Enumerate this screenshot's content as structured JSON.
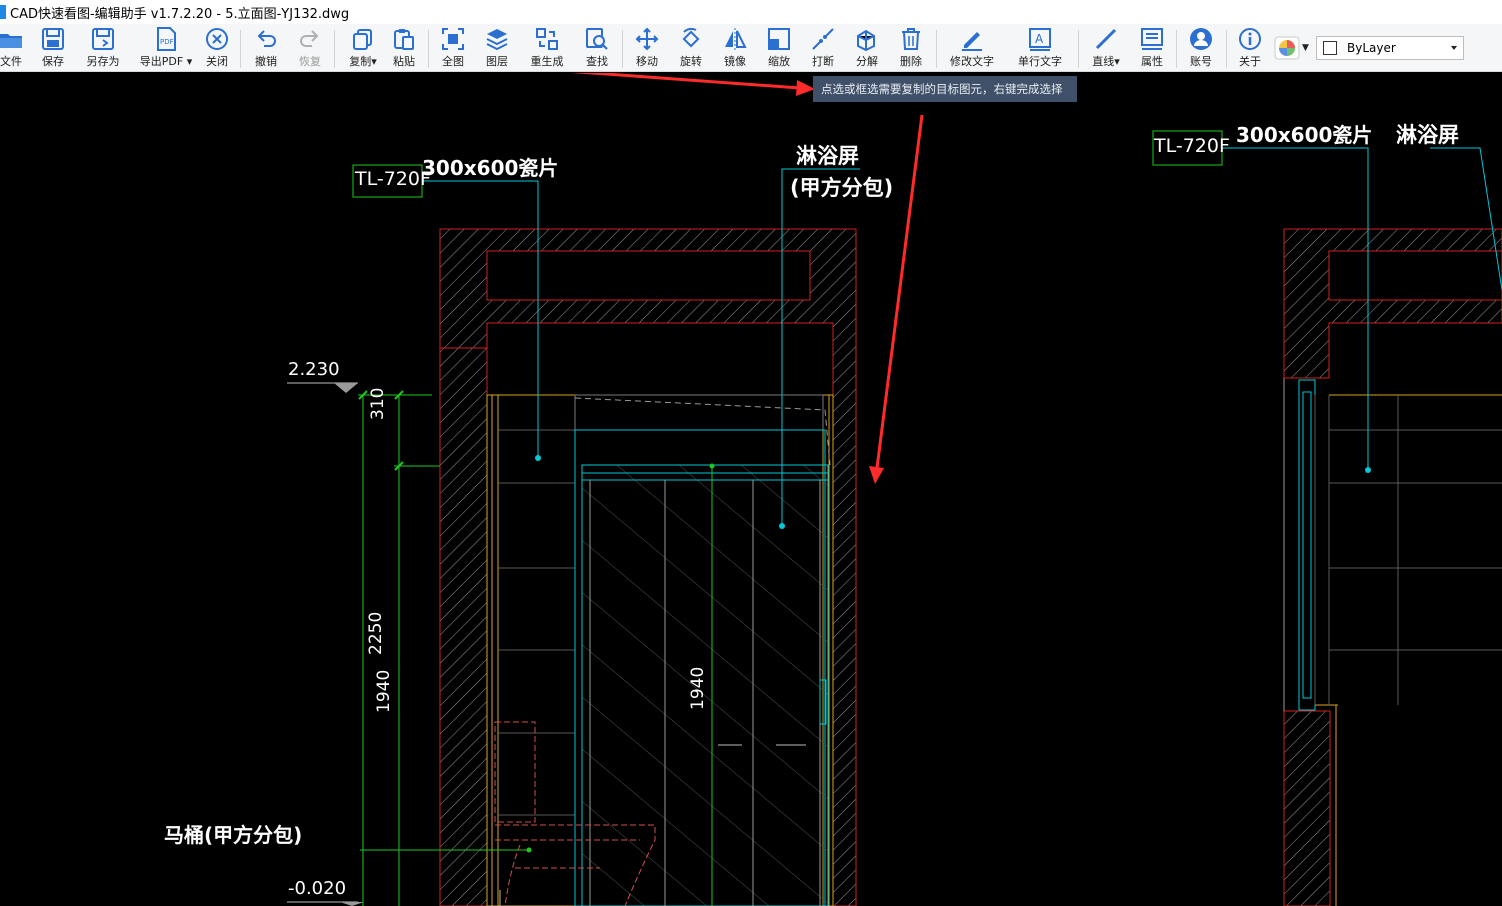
{
  "window": {
    "title": "CAD快速看图-编辑助手 v1.7.2.20 - 5.立面图-YJ132.dwg"
  },
  "toolbar": {
    "file": "文件",
    "save": "保存",
    "save_as": "另存为",
    "export_pdf": "导出PDF",
    "close": "关闭",
    "undo": "撤销",
    "redo": "恢复",
    "copy": "复制",
    "paste": "粘贴",
    "full_view": "全图",
    "layers": "图层",
    "regen": "重生成",
    "find": "查找",
    "move": "移动",
    "rotate": "旋转",
    "mirror": "镜像",
    "scale": "缩放",
    "break": "打断",
    "explode": "分解",
    "delete": "删除",
    "edit_text": "修改文字",
    "single_text": "单行文字",
    "line": "直线",
    "properties": "属性",
    "account": "账号",
    "about": "关于",
    "layer_value": "ByLayer"
  },
  "tooltip": {
    "text": "点选或框选需要复制的目标图元，右键完成选择"
  },
  "drawing": {
    "tag_left": "TL-720F",
    "tile_left": "300x600瓷片",
    "shower_left": "淋浴屏",
    "shower_left_note": "(甲方分包)",
    "tag_right": "TL-720F",
    "tile_right": "300x600瓷片",
    "shower_right": "淋浴屏",
    "level_top": "2.230",
    "level_bottom": "-0.020",
    "dim_310": "310",
    "dim_2250": "2250",
    "dim_1940_left": "1940",
    "dim_1940_mid": "1940",
    "toilet_label": "马桶(甲方分包)"
  }
}
